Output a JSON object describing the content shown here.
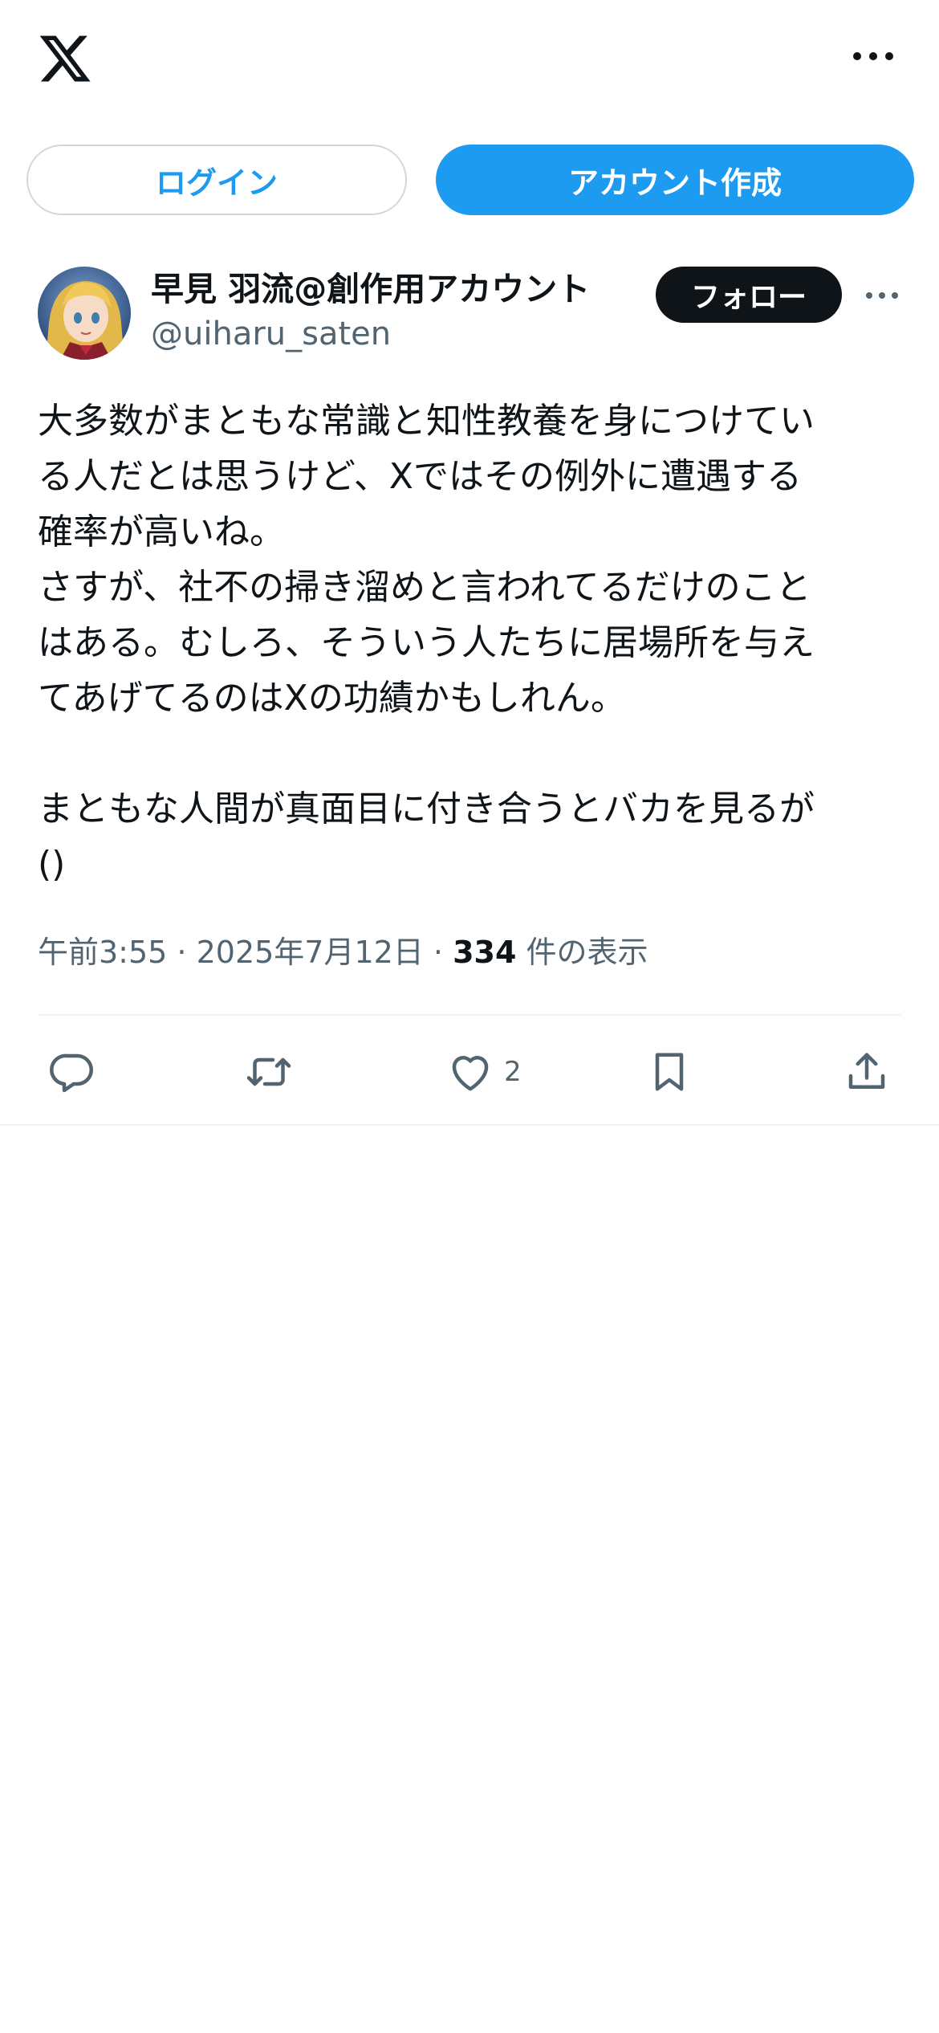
{
  "header": {
    "logo_icon": "x-logo-icon",
    "more_icon": "more-icon"
  },
  "auth": {
    "login_label": "ログイン",
    "signup_label": "アカウント作成"
  },
  "post": {
    "author": {
      "display_name": "早見 羽流@創作用アカウント",
      "handle": "@uiharu_saten",
      "avatar_icon": "avatar"
    },
    "follow_label": "フォロー",
    "text": "大多数がまともな常識と知性教養を身につけてい\nる人だとは思うけど、Xではその例外に遭遇する\n確率が高いね。\nさすが、社不の掃き溜めと言われてるだけのこと\nはある。むしろ、そういう人たちに居場所を与え\nてあげてるのはXの功績かもしれん。\n\nまともな人間が真面目に付き合うとバカを見るが\n()",
    "meta": {
      "time": "午前3:55",
      "separator": " · ",
      "date": "2025年7月12日",
      "views_count": "334",
      "views_label": " 件の表示"
    },
    "actions": {
      "reply_icon": "reply-icon",
      "repost_icon": "repost-icon",
      "like_icon": "heart-icon",
      "like_count": "2",
      "bookmark_icon": "bookmark-icon",
      "share_icon": "share-icon"
    }
  },
  "colors": {
    "accent": "#1d9bf0",
    "text": "#0f1419",
    "secondary": "#536471",
    "border": "#cfd9de"
  }
}
